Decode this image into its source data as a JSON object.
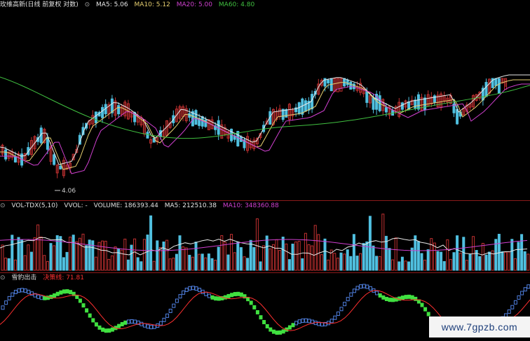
{
  "main_panel": {
    "title": "玫维高新(日线 前复权 对数)",
    "ma_labels": [
      {
        "text": "MA5: 5.06",
        "color": "#e8e8e8"
      },
      {
        "text": "MA10: 5.12",
        "color": "#e8d070"
      },
      {
        "text": "MA20: 5.00",
        "color": "#d040d0"
      },
      {
        "text": "MA60: 4.80",
        "color": "#40c040"
      }
    ],
    "low_marker": "4.06"
  },
  "volume_panel": {
    "labels": [
      {
        "text": "VOL-TDX(5,10)",
        "color": "#e0e0e0"
      },
      {
        "text": "VVOL: -",
        "color": "#e0e0e0"
      },
      {
        "text": "VOLUME: 186393.44",
        "color": "#e0e0e0"
      },
      {
        "text": "MA5: 212510.38",
        "color": "#e8e8e8"
      },
      {
        "text": "MA10: 348360.88",
        "color": "#d040d0"
      }
    ]
  },
  "indicator_panel": {
    "name": "雪豹出击",
    "line_label": "决策线: 71.81",
    "line_color": "#ff3030"
  },
  "watermark": "www.7gpzb.com",
  "colors": {
    "up": "#c03030",
    "down": "#50c0e0",
    "ma5": "#e8e8e8",
    "ma10": "#e8d070",
    "ma20": "#d040d0",
    "ma60": "#40c040",
    "ind_up": "#5080e0",
    "ind_down": "#40e040"
  }
}
